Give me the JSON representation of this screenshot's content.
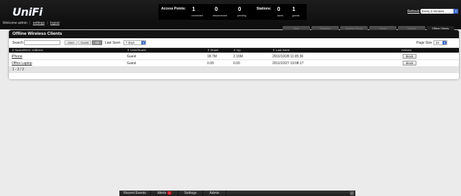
{
  "app": {
    "logo": "UniFi",
    "welcome": "Welcome admin",
    "settings_link": "settings",
    "logout_link": "logout",
    "separator": "|"
  },
  "stats": {
    "access_points_label": "Access Points:",
    "ap_connected": "1",
    "ap_connected_label": "connected",
    "ap_disconnected": "0",
    "ap_disconnected_label": "disconnected",
    "ap_pending": "0",
    "ap_pending_label": "pending",
    "stations_label": "Stations:",
    "users": "0",
    "users_label": "users",
    "guests": "1",
    "guests_label": "guests"
  },
  "refresh": {
    "label": "Refresh",
    "value": "Every 2 minutes"
  },
  "tabs": [
    "Map",
    "Statistics",
    "Access Points",
    "Users",
    "Guests",
    "Offline Clients"
  ],
  "panel": {
    "title": "Offline Wireless Clients",
    "search_label": "Search",
    "search_value": "",
    "filters": [
      "User",
      "Guest",
      "All"
    ],
    "active_filter": "All",
    "last_seen_label": "Last Seen",
    "last_seen_value": "7 days",
    "page_size_label": "Page Size",
    "page_size_value": "10"
  },
  "table": {
    "columns": [
      "Name/MAC Address",
      "User/Guest",
      "Down",
      "Up",
      "Last Seen",
      "Actions"
    ],
    "rows": [
      {
        "name": "iPhone",
        "type": "Guest",
        "down": "18.7M",
        "up": "2.16M",
        "last_seen": "2011/10/28 11:05:36",
        "action": "block"
      },
      {
        "name": "Office Laptop",
        "type": "Guest",
        "down": "0.00",
        "up": "0.00",
        "last_seen": "2011/10/27 19:08:17",
        "action": "block"
      }
    ],
    "pager": "1 - 2 / 2"
  },
  "bottom_bar": {
    "recent_events": "Recent Events",
    "alerts": "Alerts",
    "alerts_count": "1",
    "settings": "Settings",
    "admin": "Admin",
    "close_glyph": "×"
  },
  "colors": {
    "header_bg": "#111111",
    "page_bg": "#ebebeb",
    "select_accent": "#3d68c8",
    "alert_badge": "#c9161f"
  },
  "icons": {
    "sort": "sort-icon",
    "select_arrow": "select-arrow-icon",
    "close": "close-icon"
  }
}
